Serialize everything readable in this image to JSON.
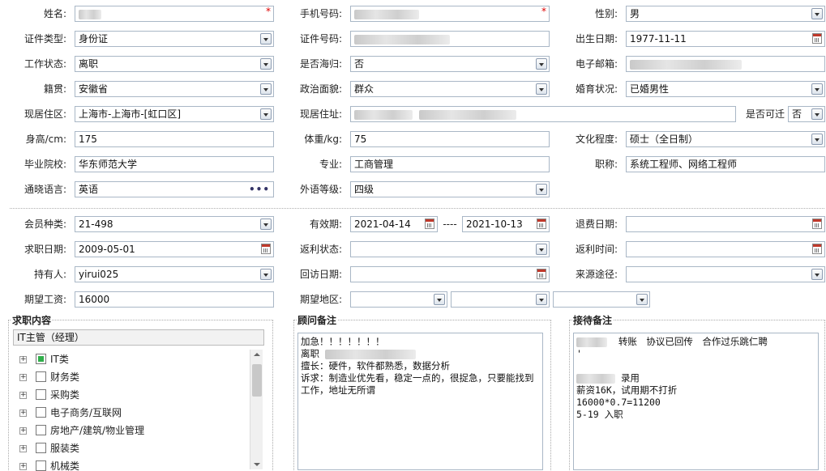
{
  "labels": {
    "name": "姓名:",
    "mobile": "手机号码:",
    "gender": "性别:",
    "id_type": "证件类型:",
    "id_no": "证件号码:",
    "birth": "出生日期:",
    "work_status": "工作状态:",
    "overseas": "是否海归:",
    "email": "电子邮箱:",
    "native": "籍贯:",
    "political": "政治面貌:",
    "marital": "婚育状况:",
    "residence": "现居住区:",
    "address": "现居住址:",
    "relocate": "是否可迁",
    "height": "身高/cm:",
    "weight": "体重/kg:",
    "education": "文化程度:",
    "school": "毕业院校:",
    "major": "专业:",
    "title": "职称:",
    "language": "通晓语言:",
    "foreign_level": "外语等级:",
    "member_type": "会员种类:",
    "valid": "有效期:",
    "refund_date": "退费日期:",
    "job_date": "求职日期:",
    "rebate_status": "返利状态:",
    "rebate_time": "返利时间:",
    "holder": "持有人:",
    "visit_date": "回访日期:",
    "source": "来源途径:",
    "salary": "期望工资:",
    "region": "期望地区:"
  },
  "values": {
    "gender": "男",
    "id_type": "身份证",
    "birth": "1977-11-11",
    "work_status": "离职",
    "overseas": "否",
    "native": "安徽省",
    "political": "群众",
    "marital": "已婚男性",
    "residence": "上海市-上海市-[虹口区]",
    "relocate": "否",
    "height": "175",
    "weight": "75",
    "education": "硕士（全日制）",
    "school": "华东师范大学",
    "major": "工商管理",
    "title": "系统工程师、网络工程师",
    "language": "英语",
    "foreign_level": "四级",
    "member_type": "21-498",
    "valid_from": "2021-04-14",
    "valid_sep": "----",
    "valid_to": "2021-10-13",
    "job_date": "2009-05-01",
    "holder": "yirui025",
    "salary": "16000",
    "more_button": "•••"
  },
  "job_content": {
    "title": "求职内容",
    "selected": "IT主管（经理）",
    "tree": [
      {
        "label": "IT类",
        "checked": true
      },
      {
        "label": "财务类",
        "checked": false
      },
      {
        "label": "采购类",
        "checked": false
      },
      {
        "label": "电子商务/互联网",
        "checked": false
      },
      {
        "label": "房地产/建筑/物业管理",
        "checked": false
      },
      {
        "label": "服装类",
        "checked": false
      },
      {
        "label": "机械类",
        "checked": false
      }
    ],
    "expand_glyph": "+"
  },
  "advisor_notes": {
    "title": "顾问备注",
    "line1": "加急！！！！！！！",
    "line2_prefix": "离职",
    "line3": "擅长：硬件，软件都熟悉，数据分析",
    "line4": "诉求：制造业优先看，稳定一点的，很捉急，只要能找到工作，地址无所谓"
  },
  "reception_notes": {
    "title": "接待备注",
    "line1_suffix": "转账　协议已回传　合作过乐跳仁聘",
    "line2": "'",
    "line3_suffix": "录用",
    "line4": "薪资16K，试用期不打折",
    "line5": "16000*0.7=11200",
    "line6": "5-19 入职"
  },
  "required_mark": "*"
}
